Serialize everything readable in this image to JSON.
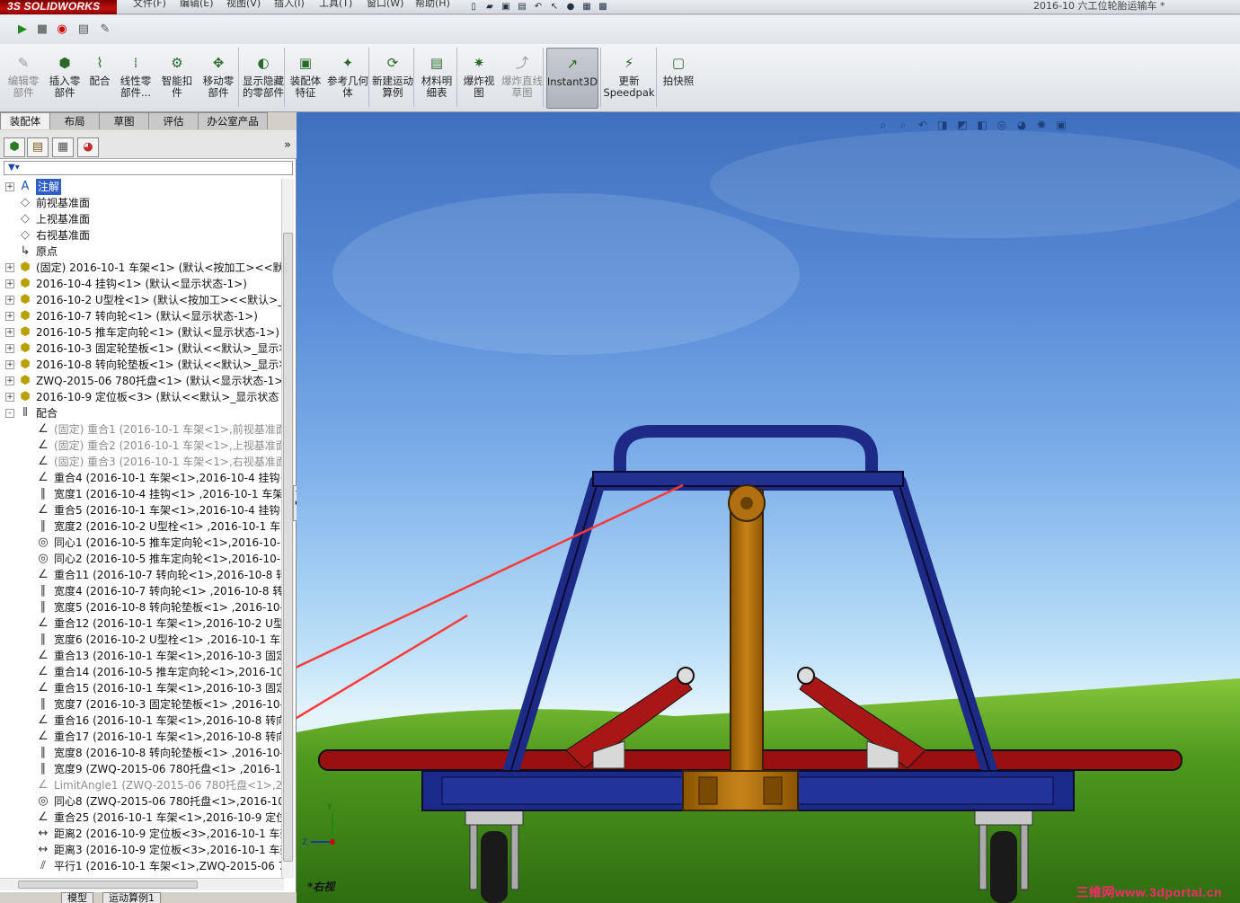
{
  "app": {
    "logo": "SOLIDWORKS",
    "logo_prefix": "3S",
    "document_title": "2016-10 六工位轮胎运输车 *"
  },
  "menu": [
    "文件(F)",
    "编辑(E)",
    "视图(V)",
    "插入(I)",
    "工具(T)",
    "窗口(W)",
    "帮助(H)"
  ],
  "commands": [
    {
      "label": "编辑零部件",
      "icon": "edit-component-icon",
      "disabled": true
    },
    {
      "label": "插入零部件",
      "icon": "insert-components-icon",
      "disabled": false
    },
    {
      "label": "配合",
      "icon": "mate-icon",
      "disabled": false
    },
    {
      "label": "线性零部件...",
      "icon": "linear-pattern-icon",
      "disabled": false
    },
    {
      "label": "智能扣件",
      "icon": "smart-fasteners-icon",
      "disabled": false
    },
    {
      "label": "移动零部件",
      "icon": "move-component-icon",
      "disabled": false
    },
    {
      "label": "显示隐藏的零部件",
      "icon": "show-hidden-icon",
      "disabled": false
    },
    {
      "label": "装配体特征",
      "icon": "assembly-features-icon",
      "disabled": false
    },
    {
      "label": "参考几何体",
      "icon": "reference-geometry-icon",
      "disabled": false
    },
    {
      "label": "新建运动算例",
      "icon": "motion-study-icon",
      "disabled": false
    },
    {
      "label": "材料明细表",
      "icon": "bom-icon",
      "disabled": false
    },
    {
      "label": "爆炸视图",
      "icon": "exploded-view-icon",
      "disabled": false
    },
    {
      "label": "爆炸直线草图",
      "icon": "explode-line-icon",
      "disabled": true
    },
    {
      "label": "Instant3D",
      "icon": "instant3d-icon",
      "disabled": false,
      "active": true
    },
    {
      "label": "更新Speedpak",
      "icon": "speedpak-icon",
      "disabled": false
    },
    {
      "label": "拍快照",
      "icon": "snapshot-icon",
      "disabled": false
    }
  ],
  "tabs": [
    "装配体",
    "布局",
    "草图",
    "评估",
    "办公室产品"
  ],
  "bottom_tabs": [
    "模型",
    "运动算例1"
  ],
  "tree": [
    {
      "label": "注解",
      "icon": "annotation-icon",
      "level": 0,
      "expander": "+",
      "highlight": true
    },
    {
      "label": "前视基准面",
      "icon": "plane-icon",
      "level": 0
    },
    {
      "label": "上视基准面",
      "icon": "plane-icon",
      "level": 0
    },
    {
      "label": "右视基准面",
      "icon": "plane-icon",
      "level": 0
    },
    {
      "label": "原点",
      "icon": "origin-icon",
      "level": 0
    },
    {
      "label": "(固定) 2016-10-1 车架<1> (默认<按加工><<默认",
      "icon": "part-icon",
      "level": 0,
      "expander": "+"
    },
    {
      "label": "2016-10-4 挂钩<1> (默认<显示状态-1>)",
      "icon": "part-icon",
      "level": 0,
      "expander": "+"
    },
    {
      "label": "2016-10-2 U型栓<1> (默认<按加工><<默认>_显",
      "icon": "part-icon",
      "level": 0,
      "expander": "+"
    },
    {
      "label": "2016-10-7 转向轮<1> (默认<显示状态-1>)",
      "icon": "part-icon",
      "level": 0,
      "expander": "+"
    },
    {
      "label": "2016-10-5 推车定向轮<1> (默认<显示状态-1>)",
      "icon": "part-icon",
      "level": 0,
      "expander": "+"
    },
    {
      "label": "2016-10-3 固定轮垫板<1> (默认<<默认>_显示状",
      "icon": "part-icon",
      "level": 0,
      "expander": "+"
    },
    {
      "label": "2016-10-8 转向轮垫板<1> (默认<<默认>_显示状",
      "icon": "part-icon",
      "level": 0,
      "expander": "+"
    },
    {
      "label": "ZWQ-2015-06 780托盘<1> (默认<显示状态-1>)",
      "icon": "part-icon",
      "level": 0,
      "expander": "+"
    },
    {
      "label": "2016-10-9 定位板<3> (默认<<默认>_显示状态 1",
      "icon": "part-icon",
      "level": 0,
      "expander": "+"
    },
    {
      "label": "配合",
      "icon": "mates-folder-icon",
      "level": 0,
      "expander": "-"
    },
    {
      "label": "(固定) 重合1 (2016-10-1 车架<1>,前视基准面",
      "icon": "coincident-icon",
      "level": 1,
      "grey": true
    },
    {
      "label": "(固定) 重合2 (2016-10-1 车架<1>,上视基准面",
      "icon": "coincident-icon",
      "level": 1,
      "grey": true
    },
    {
      "label": "(固定) 重合3 (2016-10-1 车架<1>,右视基准面",
      "icon": "coincident-icon",
      "level": 1,
      "grey": true
    },
    {
      "label": "重合4 (2016-10-1 车架<1>,2016-10-4 挂钩<",
      "icon": "coincident-icon",
      "level": 1
    },
    {
      "label": "宽度1 (2016-10-4 挂钩<1> ,2016-10-1 车架<",
      "icon": "width-icon",
      "level": 1
    },
    {
      "label": "重合5 (2016-10-1 车架<1>,2016-10-4 挂钩<",
      "icon": "coincident-icon",
      "level": 1
    },
    {
      "label": "宽度2 (2016-10-2 U型栓<1> ,2016-10-1 车架",
      "icon": "width-icon",
      "level": 1
    },
    {
      "label": "同心1 (2016-10-5 推车定向轮<1>,2016-10-3",
      "icon": "concentric-icon",
      "level": 1
    },
    {
      "label": "同心2 (2016-10-5 推车定向轮<1>,2016-10-3",
      "icon": "concentric-icon",
      "level": 1
    },
    {
      "label": "重合11 (2016-10-7 转向轮<1>,2016-10-8 转向",
      "icon": "coincident-icon",
      "level": 1
    },
    {
      "label": "宽度4 (2016-10-7 转向轮<1> ,2016-10-8 转向",
      "icon": "width-icon",
      "level": 1
    },
    {
      "label": "宽度5 (2016-10-8 转向轮垫板<1> ,2016-10-7",
      "icon": "width-icon",
      "level": 1
    },
    {
      "label": "重合12 (2016-10-1 车架<1>,2016-10-2 U型栓",
      "icon": "coincident-icon",
      "level": 1
    },
    {
      "label": "宽度6 (2016-10-2 U型栓<1> ,2016-10-1 车架",
      "icon": "width-icon",
      "level": 1
    },
    {
      "label": "重合13 (2016-10-1 车架<1>,2016-10-3 固定轮",
      "icon": "coincident-icon",
      "level": 1
    },
    {
      "label": "重合14 (2016-10-5 推车定向轮<1>,2016-10-3",
      "icon": "coincident-icon",
      "level": 1
    },
    {
      "label": "重合15 (2016-10-1 车架<1>,2016-10-3 固定轮",
      "icon": "coincident-icon",
      "level": 1
    },
    {
      "label": "宽度7 (2016-10-3 固定轮垫板<1> ,2016-10-1",
      "icon": "width-icon",
      "level": 1
    },
    {
      "label": "重合16 (2016-10-1 车架<1>,2016-10-8 转向轮",
      "icon": "coincident-icon",
      "level": 1
    },
    {
      "label": "重合17 (2016-10-1 车架<1>,2016-10-8 转向轮",
      "icon": "coincident-icon",
      "level": 1
    },
    {
      "label": "宽度8 (2016-10-8 转向轮垫板<1> ,2016-10-1",
      "icon": "width-icon",
      "level": 1
    },
    {
      "label": "宽度9 (ZWQ-2015-06 780托盘<1> ,2016-10-",
      "icon": "width-icon",
      "level": 1
    },
    {
      "label": "LimitAngle1 (ZWQ-2015-06 780托盘<1>,201",
      "icon": "limit-angle-icon",
      "level": 1,
      "grey": true
    },
    {
      "label": "同心8 (ZWQ-2015-06 780托盘<1>,2016-10-",
      "icon": "concentric-icon",
      "level": 1
    },
    {
      "label": "重合25 (2016-10-1 车架<1>,2016-10-9 定位板",
      "icon": "coincident-icon",
      "level": 1
    },
    {
      "label": "距离2 (2016-10-9 定位板<3>,2016-10-1 车架",
      "icon": "distance-icon",
      "level": 1
    },
    {
      "label": "距离3 (2016-10-9 定位板<3>,2016-10-1 车架",
      "icon": "distance-icon",
      "level": 1
    },
    {
      "label": "平行1 (2016-10-1 车架<1>,ZWQ-2015-06 78",
      "icon": "parallel-icon",
      "level": 1
    }
  ],
  "viewport": {
    "view_name": "*右视",
    "watermark": "三维网www.3dportal.cn"
  }
}
